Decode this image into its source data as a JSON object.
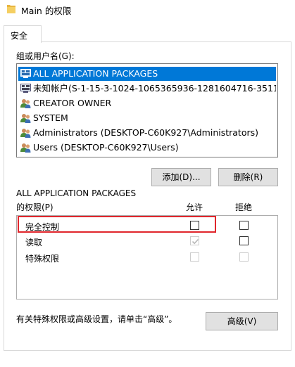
{
  "window": {
    "title": "Main 的权限"
  },
  "tabs": [
    {
      "label": "安全"
    }
  ],
  "groups": {
    "label": "组或用户名(G):",
    "items": [
      {
        "label": "ALL APPLICATION PACKAGES",
        "icon": "app-packages-icon",
        "selected": true
      },
      {
        "label": "未知帐户(S-1-15-3-1024-1065365936-1281604716-351173...",
        "icon": "unknown-account-icon",
        "selected": false
      },
      {
        "label": "CREATOR OWNER",
        "icon": "users-group-icon",
        "selected": false
      },
      {
        "label": "SYSTEM",
        "icon": "users-group-icon",
        "selected": false
      },
      {
        "label": "Administrators (DESKTOP-C60K927\\Administrators)",
        "icon": "users-group-icon",
        "selected": false
      },
      {
        "label": "Users (DESKTOP-C60K927\\Users)",
        "icon": "users-group-icon",
        "selected": false
      }
    ],
    "add_label": "添加(D)...",
    "remove_label": "删除(R)"
  },
  "permissions": {
    "title": "ALL APPLICATION PACKAGES",
    "subtitle": "的权限(P)",
    "allow_label": "允许",
    "deny_label": "拒绝",
    "rows": [
      {
        "label": "完全控制",
        "allow": false,
        "deny": false,
        "enabled": true
      },
      {
        "label": "读取",
        "allow": true,
        "deny": false,
        "enabled": true
      },
      {
        "label": "特殊权限",
        "allow": false,
        "deny": false,
        "enabled": false
      }
    ]
  },
  "footer": {
    "text": "有关特殊权限或高级设置，请单击“高级”。",
    "advanced_label": "高级(V)"
  },
  "colors": {
    "selection": "#0078d7",
    "highlight": "#e0262c"
  }
}
